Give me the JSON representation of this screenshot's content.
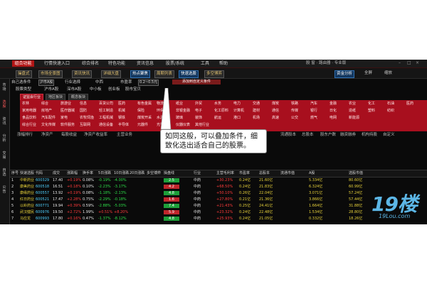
{
  "menubar": {
    "app_button": "组合功能",
    "items": [
      "行情快速入口",
      "综合排名",
      "特色功能",
      "资讯信息",
      "股票/系统",
      "工具",
      "帮助"
    ],
    "window_title": "股 窗 · 路由器 · 专业版"
  },
  "toolbar": {
    "buttons": [
      "操盘式",
      "市场全景图",
      "资讯快讯",
      "详细大盘",
      "热点聚焦",
      "周期列表",
      "快速选股",
      "多空博弈"
    ],
    "right_buttons": [
      "资金分析",
      "全屏",
      "缩放"
    ]
  },
  "filter": {
    "label": "自己选条件",
    "market": "沪市A股",
    "industry_label": "行业选择",
    "region_label": "中西",
    "pe_label": "市盈率",
    "range": "0.2~0.5元",
    "add_condition": "添加到自定义条件"
  },
  "categories": [
    "股票类型",
    "沪市A股",
    "深市A股",
    "中小板",
    "创业板",
    "股市宝贝"
  ],
  "tabs": [
    "证监会行业",
    "地区板块",
    "概念板块"
  ],
  "sectors": [
    [
      "农林",
      "综合",
      "旅游业",
      "信息",
      "百货公司",
      "医药",
      "有色金属",
      "物流",
      "纸业",
      "外贸",
      "水务",
      "电力",
      "交通",
      "煤炭",
      "铁路",
      "汽车",
      "金融",
      "农业",
      "化工",
      "石油",
      "医药"
    ],
    [
      "家用电器",
      "房地产",
      "医疗器械",
      "国防",
      "轻工制造",
      "机械",
      "保险",
      "环保",
      "非银金融",
      "电子",
      "化工原料",
      "计算机",
      "建材",
      "通信",
      "传媒",
      "银行",
      "日化",
      "造纸",
      "塑料",
      "纺织"
    ],
    [
      "食品饮料",
      "汽车配件",
      "家电",
      "农牧饲渔",
      "工程机械",
      "钢铁",
      "煤炭开采",
      "水泥",
      "玻璃",
      "装饰",
      "航运",
      "港口",
      "机场",
      "高速",
      "公交",
      "燃气",
      "电网",
      "新能源"
    ],
    [
      "综合行业",
      "文化传媒",
      "软件服务",
      "互联网",
      "通信设备",
      "半导体",
      "元器件",
      "光学",
      "仪器仪表",
      "其他行业"
    ]
  ],
  "sub_row": [
    "涨幅排行",
    "净资产",
    "每股收益",
    "净资产收益率",
    "主营业务",
    "流通股本",
    "总股本",
    "股东户数",
    "融资融券",
    "机构持股",
    "自定义"
  ],
  "callout": {
    "text": "如同这般，可以叠加条件，细致化选出适合自己的股票。"
  },
  "table": {
    "headers": [
      "序号",
      "快速选股",
      "代码",
      "成交",
      "涨跌幅",
      "换手率",
      "5日涨跌",
      "10日涨跌",
      "20日涨跌",
      "多空博弈",
      "操盘线",
      "行业",
      "主营毛利率",
      "市盈率",
      "总股本",
      "流通市值",
      "A股",
      "选股市值"
    ],
    "rows": [
      [
        "1",
        "中新药业",
        "600329",
        "17.40",
        "+0.19%",
        "0.08%",
        "-0.19%",
        "-4.00%",
        "",
        "",
        "2.5",
        "中药",
        "+30.23%",
        "0.24亿",
        "21.60亿",
        "",
        "5.334亿",
        "80.60亿"
      ],
      [
        "2",
        "康美药业",
        "600518",
        "16.51",
        "+0.18%",
        "0.10%",
        "-2.23%",
        "-3.17%",
        "",
        "",
        "4.2",
        "中药",
        "+68.50%",
        "0.24亿",
        "21.83亿",
        "",
        "6.324亿",
        "60.99亿"
      ],
      [
        "3",
        "康缘药业",
        "600557",
        "13.92",
        "+0.19%",
        "0.08%",
        "-1.18%",
        "-2.13%",
        "",
        "",
        "4.8",
        "中药",
        "+50.10%",
        "0.26亿",
        "22.04亿",
        "",
        "3.071亿",
        "57.24亿"
      ],
      [
        "4",
        "红日药业",
        "600521",
        "17.47",
        "+2.28%",
        "0.75%",
        "-2.29%",
        "-0.18%",
        "",
        "",
        "1.6",
        "中药",
        "+27.80%",
        "0.21亿",
        "21.36亿",
        "",
        "3.866亿",
        "57.44亿"
      ],
      [
        "5",
        "以岭药业",
        "600771",
        "19.94",
        "+0.39%",
        "0.59%",
        "-2.88%",
        "-5.03%",
        "",
        "",
        "7.4",
        "中药",
        "+21.43%",
        "0.25亿",
        "24.41亿",
        "",
        "1.664亿",
        "31.88亿"
      ],
      [
        "6",
        "武汉健民",
        "600976",
        "19.50",
        "+2.72%",
        "1.99%",
        "+0.51%",
        "+8.20%",
        "",
        "",
        "5.9",
        "中药",
        "+23.32%",
        "0.24亿",
        "22.48亿",
        "",
        "1.534亿",
        "28.80亿"
      ],
      [
        "7",
        "马应龙",
        "600993",
        "17.80",
        "+0.16%",
        "0.47%",
        "-1.37%",
        "-8.12%",
        "",
        "",
        "4.8",
        "中药",
        "+25.93%",
        "0.24亿",
        "21.05亿",
        "",
        "0.332亿",
        "18.26亿"
      ]
    ]
  },
  "watermark": {
    "brand": "19楼",
    "url": "19Lou.com"
  },
  "colors": {
    "up": "#ff3b3b",
    "down": "#2ee04a",
    "sector_bg": "#a80f1e",
    "accent_blue": "#12365e",
    "watermark": "#5cb6e6"
  }
}
